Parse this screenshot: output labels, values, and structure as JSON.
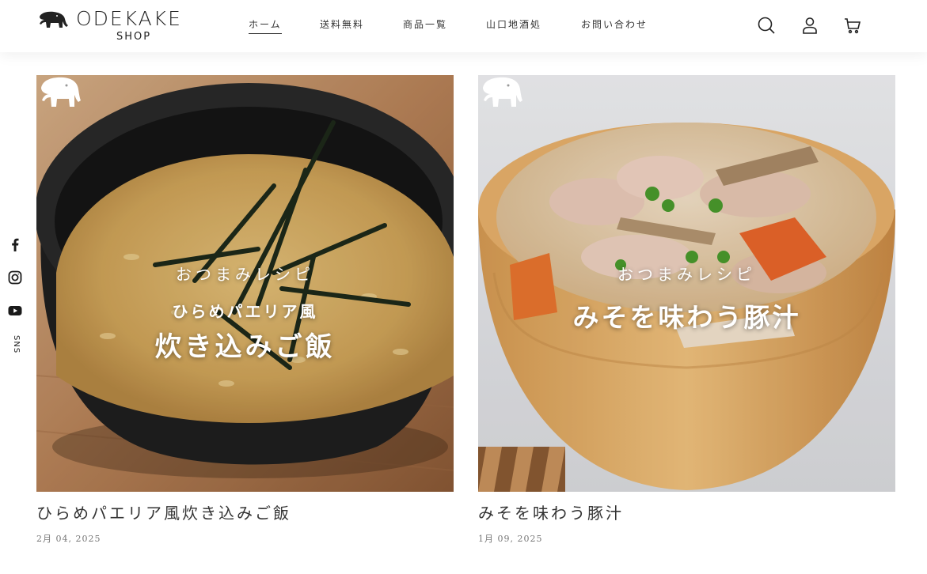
{
  "header": {
    "logo_main": "ODEKAKE",
    "logo_sub": "SHOP",
    "nav": [
      {
        "label": "ホーム",
        "active": true
      },
      {
        "label": "送料無料"
      },
      {
        "label": "商品一覧"
      },
      {
        "label": "山口地酒処"
      },
      {
        "label": "お問い合わせ"
      }
    ],
    "icons": [
      "search-icon",
      "account-icon",
      "cart-icon"
    ]
  },
  "social": {
    "icons": [
      "facebook-icon",
      "instagram-icon",
      "youtube-icon"
    ],
    "label": "SNS"
  },
  "articles": [
    {
      "overlay_kicker": "おつまみレシピ",
      "overlay_sub": "ひらめパエリア風",
      "overlay_main": "炊き込みご飯",
      "title": "ひらめパエリア風炊き込みご飯",
      "date": "2月 04, 2025"
    },
    {
      "overlay_kicker": "おつまみレシピ",
      "overlay_main": "みそを味わう豚汁",
      "title": "みそを味わう豚汁",
      "date": "1月 09, 2025"
    }
  ],
  "colors": {
    "text": "#2b2b2b",
    "muted": "#777777",
    "background": "#ffffff"
  }
}
